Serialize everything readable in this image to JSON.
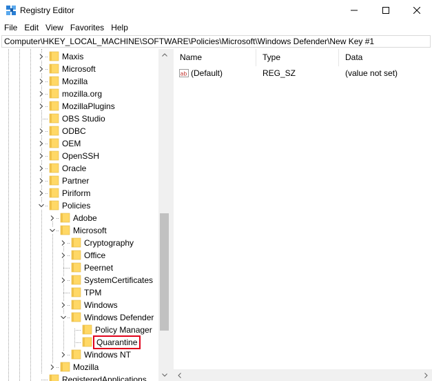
{
  "window": {
    "title": "Registry Editor"
  },
  "menu": {
    "items": [
      "File",
      "Edit",
      "View",
      "Favorites",
      "Help"
    ]
  },
  "address": {
    "path": "Computer\\HKEY_LOCAL_MACHINE\\SOFTWARE\\Policies\\Microsoft\\Windows Defender\\New Key #1"
  },
  "tree": {
    "nodes": [
      {
        "label": "Maxis",
        "expander": "collapsed"
      },
      {
        "label": "Microsoft",
        "expander": "collapsed"
      },
      {
        "label": "Mozilla",
        "expander": "collapsed"
      },
      {
        "label": "mozilla.org",
        "expander": "collapsed"
      },
      {
        "label": "MozillaPlugins",
        "expander": "collapsed"
      },
      {
        "label": "OBS Studio",
        "expander": "none"
      },
      {
        "label": "ODBC",
        "expander": "collapsed"
      },
      {
        "label": "OEM",
        "expander": "collapsed"
      },
      {
        "label": "OpenSSH",
        "expander": "collapsed"
      },
      {
        "label": "Oracle",
        "expander": "collapsed"
      },
      {
        "label": "Partner",
        "expander": "collapsed"
      },
      {
        "label": "Piriform",
        "expander": "collapsed"
      },
      {
        "label": "Policies",
        "expander": "expanded"
      },
      {
        "label": "Adobe",
        "expander": "collapsed"
      },
      {
        "label": "Microsoft",
        "expander": "expanded"
      },
      {
        "label": "Cryptography",
        "expander": "collapsed"
      },
      {
        "label": "Office",
        "expander": "collapsed"
      },
      {
        "label": "Peernet",
        "expander": "none"
      },
      {
        "label": "SystemCertificates",
        "expander": "collapsed"
      },
      {
        "label": "TPM",
        "expander": "none"
      },
      {
        "label": "Windows",
        "expander": "collapsed"
      },
      {
        "label": "Windows Defender",
        "expander": "expanded"
      },
      {
        "label": "Policy Manager",
        "expander": "none"
      },
      {
        "label": "Quarantine",
        "expander": "none",
        "highlighted": true
      },
      {
        "label": "Windows NT",
        "expander": "collapsed"
      },
      {
        "label": "Mozilla",
        "expander": "collapsed"
      },
      {
        "label": "RegisteredApplications",
        "expander": "none"
      }
    ]
  },
  "list": {
    "columns": [
      "Name",
      "Type",
      "Data"
    ],
    "rows": [
      {
        "icon": "string-value-icon",
        "name": "(Default)",
        "type": "REG_SZ",
        "data": "(value not set)"
      }
    ]
  },
  "colors": {
    "folder": "#ffd866",
    "highlight": "#e0001b",
    "scrollbar_track": "#f0f0f0",
    "scrollbar_thumb": "#c1c1c1"
  }
}
